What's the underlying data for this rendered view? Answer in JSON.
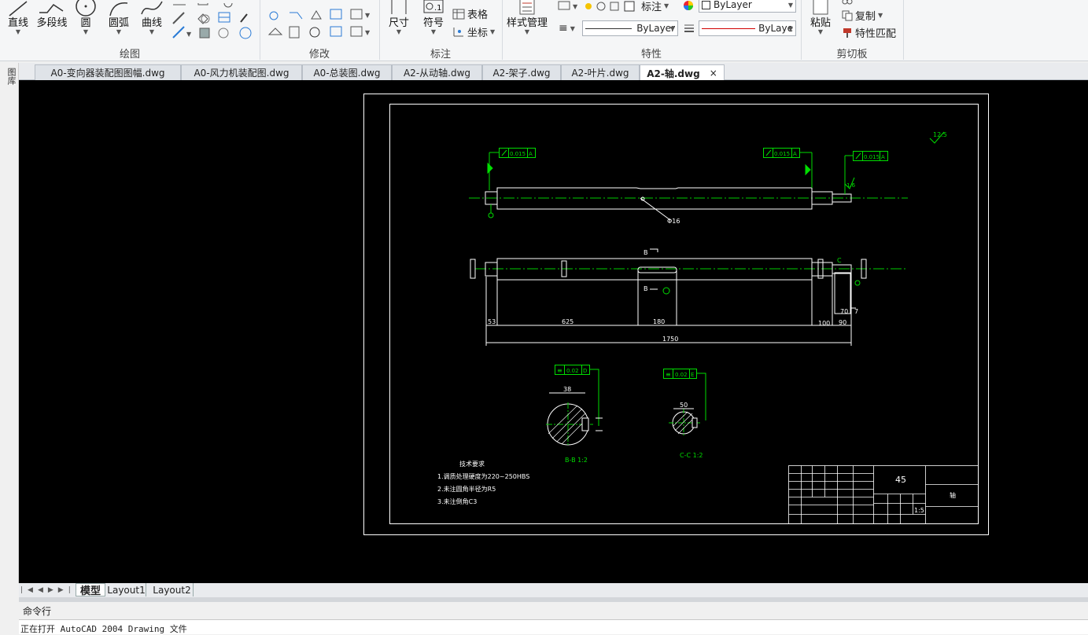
{
  "ribbon": {
    "draw": {
      "line": "直线",
      "polyline": "多段线",
      "circle": "圆",
      "arc": "圆弧",
      "curve": "曲线",
      "group": "绘图"
    },
    "modify": {
      "group": "修改"
    },
    "annotate": {
      "dimension": "尺寸",
      "symbol": "符号",
      "table": "表格",
      "coords": "坐标",
      "group": "标注"
    },
    "properties": {
      "style_manager": "样式管理",
      "layer_label": "标注",
      "color_combo": "ByLayer",
      "linetype_combo": "ByLayer",
      "lineweight_combo": "ByLaye",
      "group": "特性",
      "accent_red": "#d00000"
    },
    "clipboard": {
      "paste": "粘贴",
      "copy": "复制",
      "match": "特性匹配",
      "group": "剪切板"
    }
  },
  "leftrail": {
    "label": "图库"
  },
  "file_tabs": [
    {
      "label": "A0-变向器装配图图幅.dwg"
    },
    {
      "label": "A0-风力机装配图.dwg"
    },
    {
      "label": "A0-总装图.dwg"
    },
    {
      "label": "A2-从动轴.dwg"
    },
    {
      "label": "A2-架子.dwg"
    },
    {
      "label": "A2-叶片.dwg"
    },
    {
      "label": "A2-轴.dwg",
      "close": "×"
    }
  ],
  "drawing": {
    "colors": {
      "outline": "#ffffff",
      "dim": "#00d000",
      "center": "#00c000"
    },
    "tol_1": "0.015",
    "tol_1_ref": "A",
    "tol_2": "0.015",
    "tol_2_ref": "A",
    "tol_3": "0.015",
    "tol_3_ref": "A",
    "tol_4": "0.02",
    "tol_4_ref": "D",
    "tol_5": "0.02",
    "tol_5_ref": "E",
    "rough_right": "12.5",
    "rough_small": "1.6",
    "dia_callout": "Φ16",
    "section_b_top": "B",
    "section_b_bottom": "B",
    "section_c": "C",
    "dim_53": "53",
    "dim_625": "625",
    "dim_180": "180",
    "dim_100": "100",
    "dim_90": "90",
    "dim_70": "70",
    "dim_7": "7",
    "dim_1750": "1750",
    "sec_b_width": "38",
    "sec_c_width": "50",
    "sec_b_label": "B-B 1:2",
    "sec_c_label": "C-C 1:2",
    "notes_title": "技术要求",
    "notes": [
      "1.调质处理硬度为220~250HBS",
      "2.未注圆角半径为R5",
      "3.未注倒角C3"
    ],
    "title_material": "45",
    "title_name": "轴",
    "title_scale": "1:5"
  },
  "layout_tabs": {
    "model": "模型",
    "layout1": "Layout1",
    "layout2": "Layout2"
  },
  "command": {
    "label": "命令行",
    "line": "正在打开 AutoCAD 2004 Drawing 文件"
  }
}
